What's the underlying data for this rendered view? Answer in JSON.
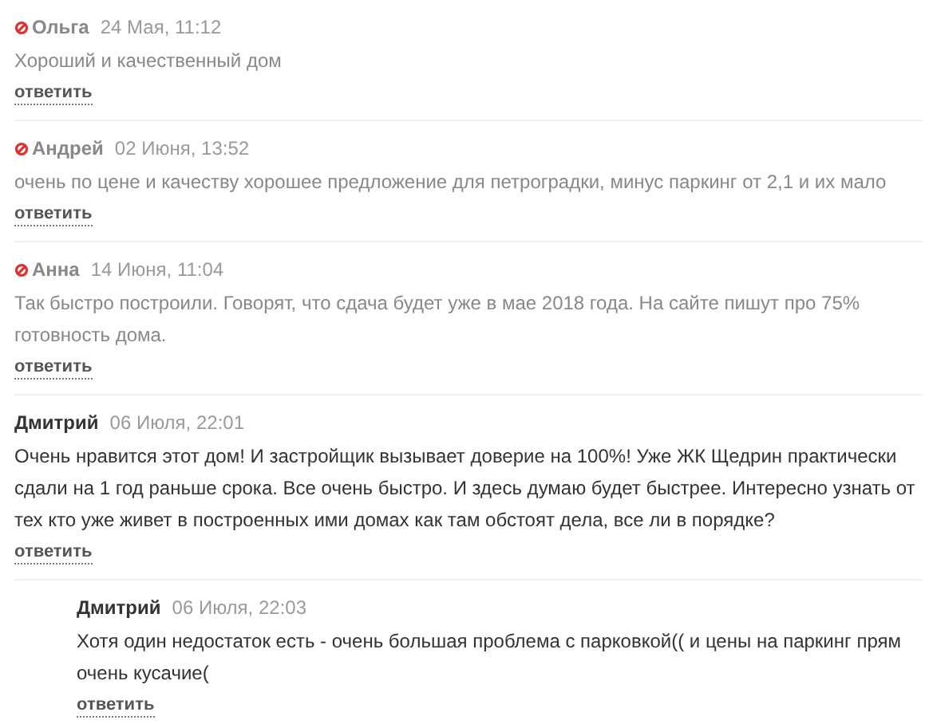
{
  "comments": [
    {
      "author": "Ольга",
      "date": "24 Мая, 11:12",
      "blocked": true,
      "text": "Хороший и качественный дом",
      "reply": "ответить"
    },
    {
      "author": "Андрей",
      "date": "02 Июня, 13:52",
      "blocked": true,
      "text": "очень по цене и качеству хорошее предложение для петроградки, минус паркинг от 2,1 и их мало",
      "reply": "ответить"
    },
    {
      "author": "Анна",
      "date": "14 Июня, 11:04",
      "blocked": true,
      "text": "Так быстро построили. Говорят, что сдача будет уже в мае 2018 года. На сайте пишут про 75% готовность дома.",
      "reply": "ответить"
    },
    {
      "author": "Дмитрий",
      "date": "06 Июля, 22:01",
      "blocked": false,
      "text": "Очень нравится этот дом! И застройщик вызывает доверие на 100%! Уже ЖК Щедрин практически сдали на 1 год раньше срока. Все очень быстро. И здесь думаю будет быстрее. Интересно узнать от тех кто уже живет в построенных ими домах как там обстоят дела, все ли в порядке?",
      "reply": "ответить",
      "children": [
        {
          "author": "Дмитрий",
          "date": "06 Июля, 22:03",
          "blocked": false,
          "text": "Хотя один недостаток есть - очень большая проблема с парковкой(( и цены на паркинг прям очень кусачие(",
          "reply": "ответить"
        }
      ]
    }
  ]
}
